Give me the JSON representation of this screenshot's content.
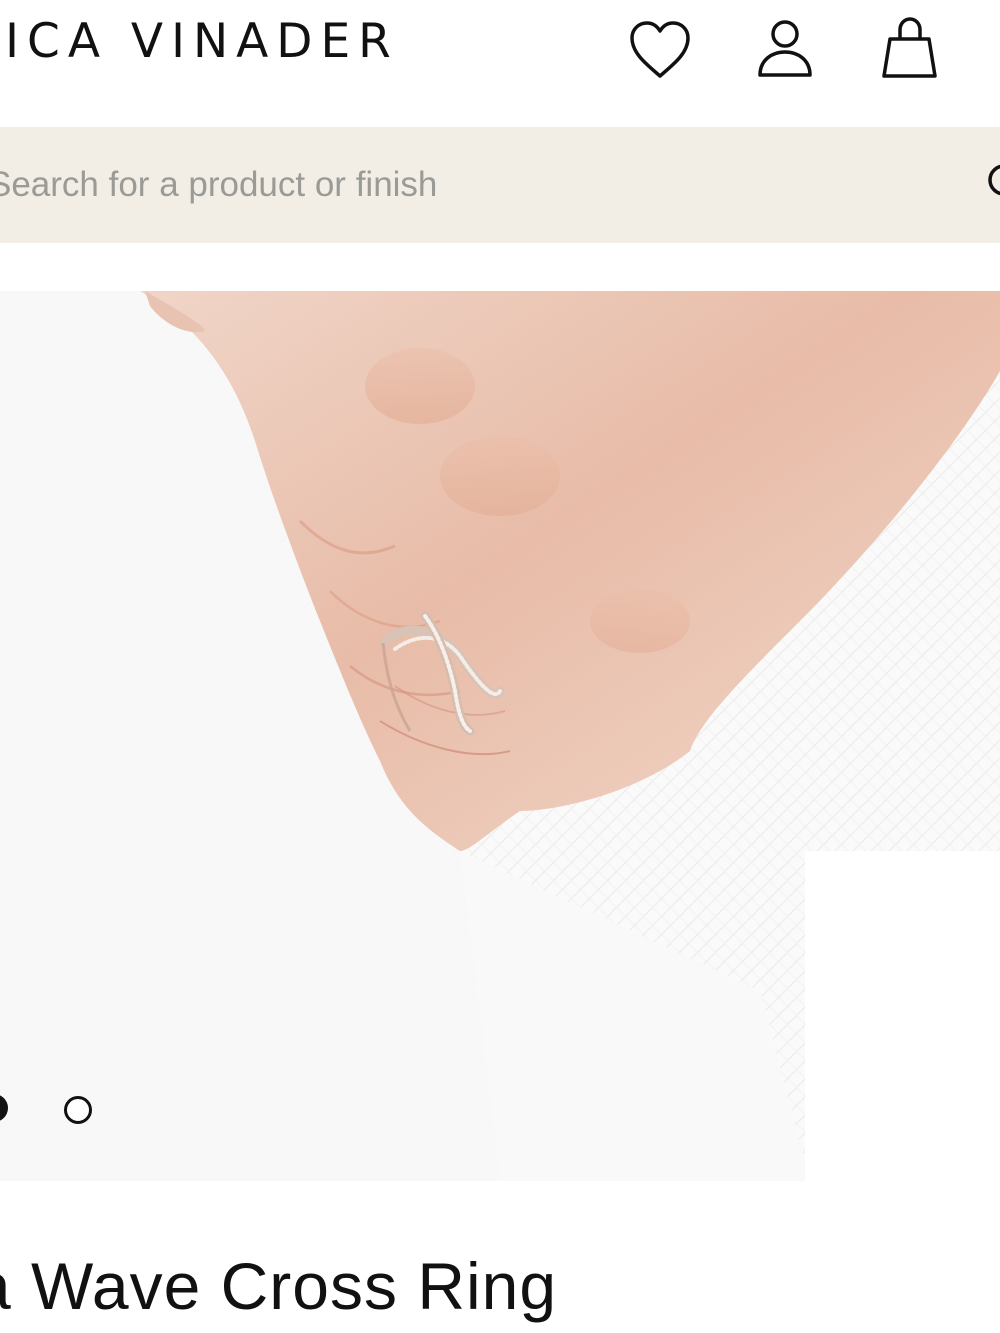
{
  "header": {
    "logo_text": "NICA VINADER",
    "icons": [
      "heart-icon",
      "user-icon",
      "shopping-bag-icon"
    ]
  },
  "search": {
    "placeholder": "Search for a product or finish",
    "icon": "search-icon"
  },
  "gallery": {
    "image_count": 2,
    "active_index": 0
  },
  "product": {
    "title": "a Wave Cross Ring"
  },
  "colors": {
    "search_bg": "#f2eee6",
    "text": "#111111",
    "placeholder": "#9a9a96"
  }
}
